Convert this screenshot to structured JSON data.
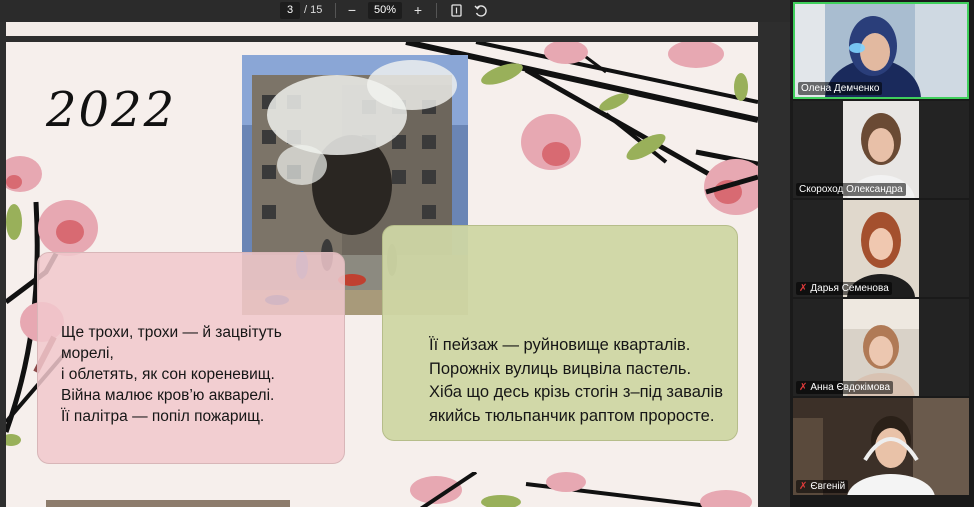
{
  "toolbar": {
    "current_page": "3",
    "total_pages": "/ 15",
    "zoom_out": "−",
    "zoom_level": "50%",
    "zoom_in": "+"
  },
  "slide": {
    "year": "2022",
    "poem_left": [
      "Ще трохи, трохи — й зацвітуть",
      "морелі,",
      "і облетять, як сон кореневищ.",
      "Війна малює кров’ю акварелі.",
      "Її палітра — попіл пожарищ."
    ],
    "poem_right": [
      "Її пейзаж — руйновище кварталів.",
      "Порожніх вулиць вицвіла пастель.",
      "Хіба що десь крізь стогін з–під завалів",
      "якийсь тюльпанчик раптом проросте."
    ]
  },
  "participants": [
    {
      "name": "Олена Демченко",
      "muted": false,
      "active": true
    },
    {
      "name": "Скороход Олександра",
      "muted": false,
      "active": false
    },
    {
      "name": "Дарья Семенова",
      "muted": true,
      "active": false
    },
    {
      "name": "Анна Євдокімова",
      "muted": true,
      "active": false
    },
    {
      "name": "Євгеній",
      "muted": true,
      "active": false
    }
  ],
  "colors": {
    "active_speaker_border": "#3fcf5c",
    "muted_icon": "#e03b3b",
    "pink_panel": "#f1c8cd",
    "green_panel": "#cfd6a4"
  }
}
